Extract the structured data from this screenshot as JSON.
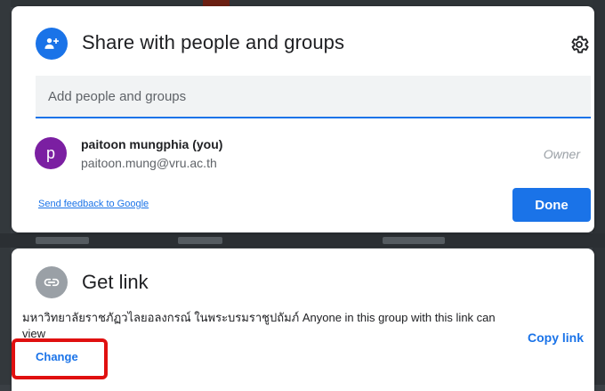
{
  "share_dialog": {
    "title": "Share with people and groups",
    "header_icon": "person-add-icon",
    "settings_icon": "gear-icon",
    "add_field": {
      "placeholder": "Add people and groups",
      "value": ""
    },
    "users": [
      {
        "avatar_letter": "p",
        "avatar_color": "#7b1fa2",
        "name": "paitoon mungphia (you)",
        "email": "paitoon.mung@vru.ac.th",
        "role": "Owner"
      }
    ],
    "feedback_link": "Send feedback to Google",
    "done_label": "Done"
  },
  "get_link": {
    "title": "Get link",
    "icon": "link-icon",
    "description": "มหาวิทยาลัยราชภัฏวไลยอลงกรณ์ ในพระบรมราชูปถัมภ์ Anyone in this group with this link can view",
    "change_label": "Change",
    "copy_link_label": "Copy link"
  },
  "colors": {
    "accent": "#1a73e8",
    "highlight": "#e01010"
  }
}
